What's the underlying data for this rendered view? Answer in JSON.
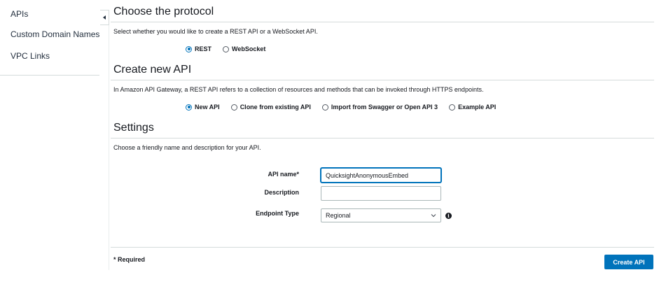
{
  "sidebar": {
    "items": [
      {
        "label": "APIs"
      },
      {
        "label": "Custom Domain Names"
      },
      {
        "label": "VPC Links"
      }
    ]
  },
  "protocol": {
    "title": "Choose the protocol",
    "description": "Select whether you would like to create a REST API or a WebSocket API.",
    "options": [
      {
        "label": "REST",
        "checked": true
      },
      {
        "label": "WebSocket",
        "checked": false
      }
    ]
  },
  "create_new": {
    "title": "Create new API",
    "description": "In Amazon API Gateway, a REST API refers to a collection of resources and methods that can be invoked through HTTPS endpoints.",
    "options": [
      {
        "label": "New API",
        "checked": true
      },
      {
        "label": "Clone from existing API",
        "checked": false
      },
      {
        "label": "Import from Swagger or Open API 3",
        "checked": false
      },
      {
        "label": "Example API",
        "checked": false
      }
    ]
  },
  "settings": {
    "title": "Settings",
    "description": "Choose a friendly name and description for your API.",
    "api_name_label": "API name*",
    "api_name_value": "QuicksightAnonymousEmbed",
    "description_label": "Description",
    "description_value": "",
    "endpoint_label": "Endpoint Type",
    "endpoint_value": "Regional"
  },
  "footer": {
    "required": "* Required",
    "create_button": "Create API"
  },
  "colors": {
    "accent": "#0073bb",
    "text": "#16191f",
    "border": "#d5dbdb"
  }
}
